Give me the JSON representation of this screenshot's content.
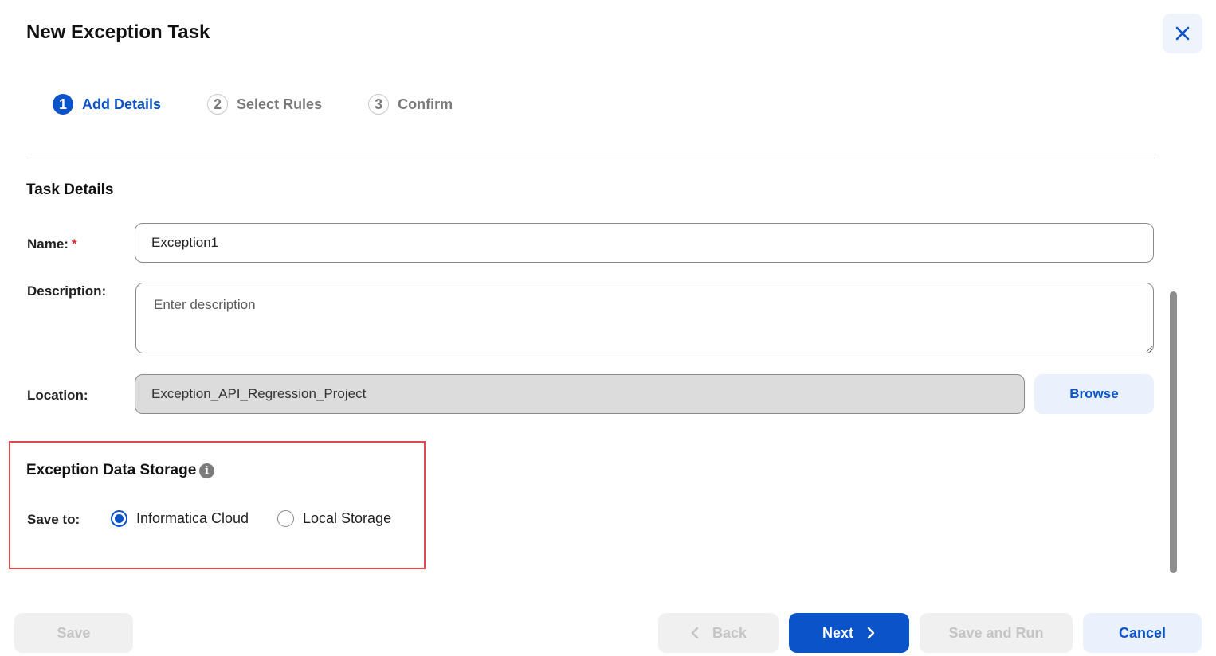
{
  "dialog": {
    "title": "New Exception Task",
    "close_icon": "close-icon"
  },
  "stepper": {
    "steps": [
      {
        "number": "1",
        "label": "Add Details",
        "state": "active"
      },
      {
        "number": "2",
        "label": "Select Rules",
        "state": "inactive"
      },
      {
        "number": "3",
        "label": "Confirm",
        "state": "inactive"
      }
    ]
  },
  "task_details": {
    "title": "Task Details",
    "name_label": "Name:",
    "required_mark": "*",
    "name_value": "Exception1",
    "description_label": "Description:",
    "description_placeholder": "Enter description",
    "location_label": "Location:",
    "location_value": "Exception_API_Regression_Project",
    "browse_label": "Browse"
  },
  "storage": {
    "title": "Exception Data Storage",
    "info_icon": "info-icon",
    "save_to_label": "Save to:",
    "options": [
      {
        "label": "Informatica Cloud",
        "selected": true
      },
      {
        "label": "Local Storage",
        "selected": false
      }
    ]
  },
  "footer": {
    "save_label": "Save",
    "back_label": "Back",
    "next_label": "Next",
    "save_and_run_label": "Save and Run",
    "cancel_label": "Cancel"
  },
  "colors": {
    "accent": "#0a53c9",
    "highlight_border": "#e04a4a",
    "required": "#d32f2f"
  }
}
